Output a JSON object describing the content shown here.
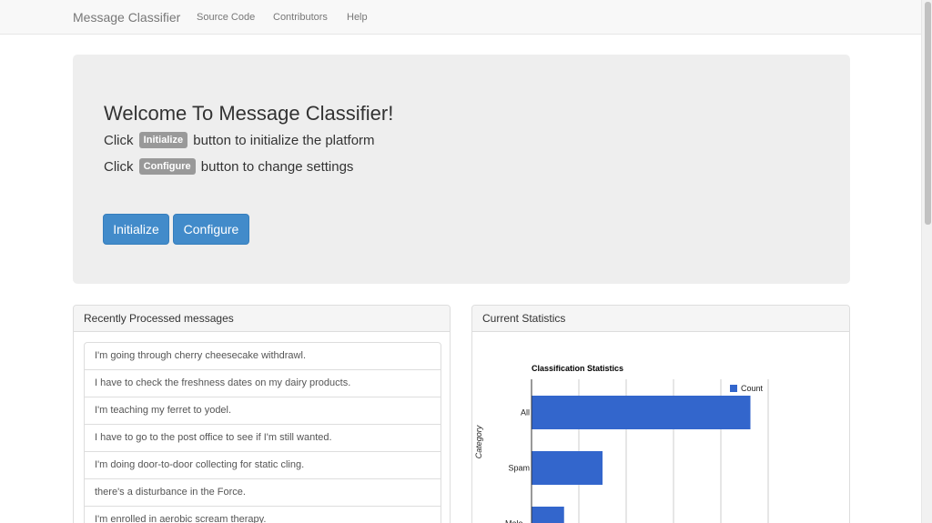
{
  "navbar": {
    "brand": "Message Classifier",
    "links": [
      "Source Code",
      "Contributors",
      "Help"
    ]
  },
  "jumbotron": {
    "title": "Welcome To Message Classifier!",
    "line1": {
      "prefix": "Click",
      "badge": "Initialize",
      "suffix": "button to initialize the platform"
    },
    "line2": {
      "prefix": "Click",
      "badge": "Configure",
      "suffix": "button to change settings"
    },
    "initialize_label": "Initialize",
    "configure_label": "Configure"
  },
  "recent_panel": {
    "title": "Recently Processed messages",
    "messages": [
      "I'm going through cherry cheesecake withdrawl.",
      "I have to check the freshness dates on my dairy products.",
      "I'm teaching my ferret to yodel.",
      "I have to go to the post office to see if I'm still wanted.",
      "I'm doing door-to-door collecting for static cling.",
      "there's a disturbance in the Force.",
      "I'm enrolled in aerobic scream therapy."
    ]
  },
  "stats_panel": {
    "title": "Current Statistics"
  },
  "colors": {
    "primary": "#428bca",
    "bar": "#3366cc",
    "badge": "#999999"
  },
  "chart_data": {
    "type": "bar",
    "orientation": "horizontal",
    "title": "Classification Statistics",
    "ylabel": "Category",
    "categories": [
      "All",
      "Spam",
      "Malicious"
    ],
    "category_labels_shown": [
      "All",
      "Spam",
      "Male..."
    ],
    "series": [
      {
        "name": "Count",
        "values": [
          37,
          12,
          5.5
        ]
      }
    ],
    "xlim": [
      0,
      40
    ],
    "grid": true,
    "legend_position": "right"
  }
}
